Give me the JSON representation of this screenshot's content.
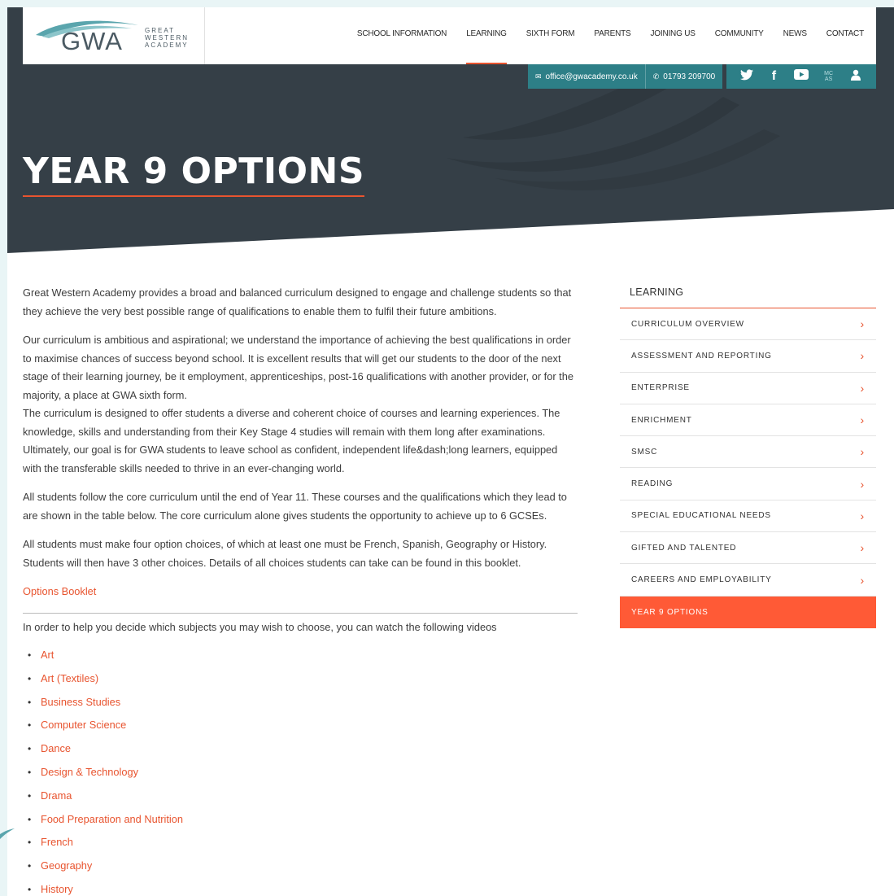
{
  "brand": {
    "logo_main": "GWA",
    "logo_sub": [
      "GREAT",
      "WESTERN",
      "ACADEMY"
    ]
  },
  "nav": {
    "items": [
      {
        "label": "SCHOOL INFORMATION"
      },
      {
        "label": "LEARNING",
        "active": true
      },
      {
        "label": "SIXTH FORM"
      },
      {
        "label": "PARENTS"
      },
      {
        "label": "JOINING US"
      },
      {
        "label": "COMMUNITY"
      },
      {
        "label": "NEWS"
      },
      {
        "label": "CONTACT"
      }
    ]
  },
  "contact": {
    "email": "office@gwacademy.co.uk",
    "phone": "01793 209700",
    "email_icon": "mail-icon",
    "phone_icon": "phone-icon"
  },
  "social": {
    "icons": [
      "twitter-icon",
      "facebook-icon",
      "youtube-icon",
      "mcas-icon",
      "user-icon"
    ],
    "mcas_top": "MC",
    "mcas_bottom": "AS"
  },
  "page": {
    "title": "YEAR 9 OPTIONS"
  },
  "content": {
    "p1": "Great Western Academy provides a broad and balanced curriculum designed to engage and challenge students so that they achieve the very best possible range of qualifications to enable them to fulfil their future ambitions.",
    "p2": "Our curriculum is ambitious and aspirational; we understand the importance of achieving the best qualifications in order to maximise chances of success beyond school. It is excellent results that will get our students to the door of the next stage of their learning journey, be it employment, apprenticeships, post-16 qualifications with another provider, or for the majority, a place at GWA sixth form.",
    "p3": "The curriculum is designed to offer students a diverse and coherent choice of courses and learning experiences. The knowledge, skills and understanding from their Key Stage 4 studies will remain with them long after examinations. Ultimately, our goal is for GWA students to leave school as confident, independent life&dash;long learners, equipped with the transferable skills needed to thrive in an ever-changing world.",
    "p4": "All students follow the core curriculum until the end of Year 11. These courses and the qualifications which they lead to are shown in the table below. The core curriculum alone gives students the opportunity to achieve up to 6 GCSEs.",
    "p5": "All students must make four option choices, of which at least one must be French, Spanish, Geography or History. Students will then have 3 other choices. Details of all choices students can take can be found in this booklet.",
    "booklet_link": "Options Booklet",
    "videos_intro": "In order to help you decide which subjects you may wish to choose, you can watch the following videos",
    "videos": [
      "Art",
      "Art (Textiles)",
      "Business Studies",
      "Computer Science",
      "Dance",
      "Design & Technology",
      "Drama",
      "Food Preparation and Nutrition",
      "French",
      "Geography",
      "History"
    ]
  },
  "sidebar": {
    "heading": "LEARNING",
    "items": [
      {
        "label": "CURRICULUM OVERVIEW"
      },
      {
        "label": "ASSESSMENT AND REPORTING"
      },
      {
        "label": "ENTERPRISE"
      },
      {
        "label": "ENRICHMENT"
      },
      {
        "label": "SMSC"
      },
      {
        "label": "READING"
      },
      {
        "label": "SPECIAL EDUCATIONAL NEEDS"
      },
      {
        "label": "GIFTED AND TALENTED"
      },
      {
        "label": "CAREERS AND EMPLOYABILITY"
      },
      {
        "label": "YEAR 9 OPTIONS",
        "active": true
      }
    ],
    "chevron": "›"
  },
  "colors": {
    "hero_bg": "#353f47",
    "accent": "#e8542f",
    "teal": "#2d7f87",
    "active_item": "#ff5a36"
  }
}
